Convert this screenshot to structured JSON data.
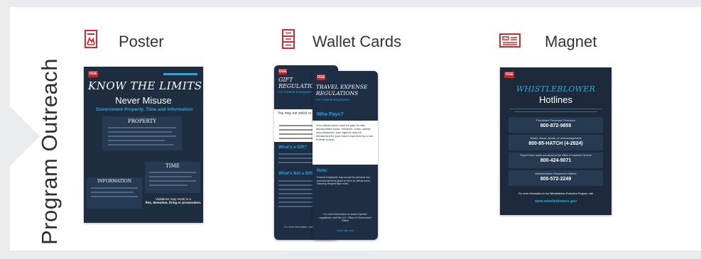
{
  "section": {
    "title": "Program Outreach"
  },
  "items": [
    {
      "label": "Poster",
      "icon": "poster-icon"
    },
    {
      "label": "Wallet Cards",
      "icon": "wallet-cards-icon"
    },
    {
      "label": "Magnet",
      "icon": "magnet-icon"
    }
  ],
  "poster": {
    "headline": "Know the Limits",
    "subhead1": "Never Misuse",
    "subhead2": "Government Property, Time and Information",
    "box1": "Property",
    "box2": "Time",
    "box3": "Information",
    "footer1": "Violations may result in a",
    "footer2": "fine, demotion, firing or prosecution."
  },
  "wallet": {
    "card1": {
      "title1": "Gift",
      "title2": "Regulations",
      "audience": "For Federal Employees",
      "q1": "You may not solicit or accept a gift:",
      "h1": "What's a Gift?",
      "h2": "What's Not a Gift?",
      "footer": "For more information, visit www.oge.gov"
    },
    "card2": {
      "title1": "Travel Expense",
      "title2": "Regulations",
      "audience": "For Federal Employees",
      "h1": "Who Pays?",
      "body": "Your official travel must be paid for with appropriated funds. However, under certain circumstances, your agency may be reimbursed for your travel expenses by a non-federal source.",
      "h2": "Note:",
      "note": "Federal employees may accept for personal use promotional items given to them on official travel, including frequent flyer miles.",
      "footer": "For more information on travel expense regulations, visit the U.S. Office of Government Ethics",
      "url": "www.oge.gov"
    }
  },
  "magnet": {
    "title1": "Whistleblower",
    "title2": "Hotlines",
    "lines": [
      {
        "label": "Prohibited Personnel Practices",
        "number": "800-872-9855"
      },
      {
        "label": "Waste, fraud, abuse, or mismanagement",
        "number": "800-85-HATCH (4-2824)"
      },
      {
        "label": "Report fraud, waste and abuse to the Office of Inspector General",
        "number": "800-424-9071"
      },
      {
        "label": "Whistleblower Disclosure Hotline",
        "number": "800-572-2249"
      }
    ],
    "footer": "For more information on the Whistleblower Protection Program, visit",
    "url": "www.whistleblowers.gov"
  },
  "colors": {
    "accent_red": "#d42a31",
    "navy": "#1f2d40",
    "cyan": "#2aa7dc"
  }
}
